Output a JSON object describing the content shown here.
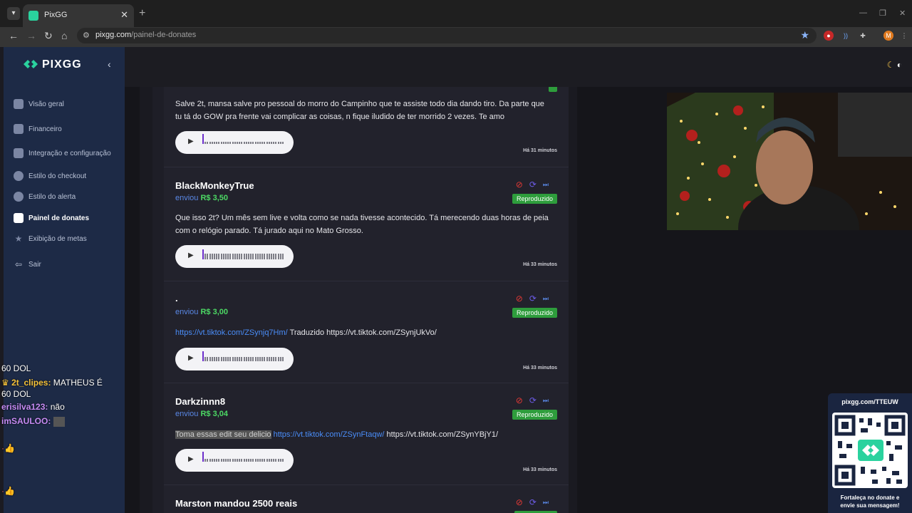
{
  "browser": {
    "tab_title": "PixGG",
    "url_domain": "pixgg.com",
    "url_path": "/painel-de-donates",
    "profile_initial": "M"
  },
  "sidebar": {
    "logo": "PIXGG",
    "items": [
      {
        "label": "Visão geral",
        "icon": "home-icon"
      },
      {
        "label": "Financeiro",
        "icon": "wallet-icon"
      },
      {
        "label": "Integração e configuração",
        "icon": "integration-icon"
      },
      {
        "label": "Estilo do checkout",
        "icon": "palette-icon"
      },
      {
        "label": "Estilo do alerta",
        "icon": "palette-icon"
      },
      {
        "label": "Painel de donates",
        "icon": "donate-icon"
      },
      {
        "label": "Exibição de metas",
        "icon": "star-icon"
      },
      {
        "label": "Sair",
        "icon": "logout-icon"
      }
    ],
    "active_index": 5
  },
  "donations": [
    {
      "name": "",
      "sent_label": "",
      "amount": "",
      "message": "Salve 2t, mansa salve pro pessoal do morro do Campinho que te assiste todo dia dando tiro. Da parte que tu tá do GOW pra frente vai complicar as coisas, n fique iludido de ter morrido 2 vezes. Te amo",
      "time": "Há 31 minutos"
    },
    {
      "name": "BlackMonkeyTrue",
      "sent_label": "enviou",
      "amount": "R$ 3,50",
      "status": "Reproduzido",
      "message": "Que isso 2t? Um mês sem live e volta como se nada tivesse acontecido. Tá merecendo duas horas de peia com o relógio parado. Tá jurado aqui no Mato Grosso.",
      "time": "Há 33 minutos"
    },
    {
      "name": ".",
      "sent_label": "enviou",
      "amount": "R$ 3,00",
      "status": "Reproduzido",
      "link": "https://vt.tiktok.com/ZSynjq7Hm/",
      "message_after": " Traduzido https://vt.tiktok.com/ZSynjUkVo/",
      "time": "Há 33 minutos"
    },
    {
      "name": "Darkzinnn8",
      "sent_label": "enviou",
      "amount": "R$ 3,04",
      "status": "Reproduzido",
      "highlight": "Toma essas edit seu delicio",
      "link": " https://vt.tiktok.com/ZSynFtaqw/",
      "message_after": " https://vt.tiktok.com/ZSynYBjY1/",
      "time": "Há 33 minutos"
    },
    {
      "name": "Marston mandou 2500 reais"
    }
  ],
  "chat": [
    {
      "user": "",
      "text": "60 DOL",
      "color": "#ffffff"
    },
    {
      "user": "2t_clipes:",
      "text": " MATHEUS É",
      "color": "#f5c23a"
    },
    {
      "user": "",
      "text": "60 DOL",
      "color": "#ffffff"
    },
    {
      "user": "erisilva123:",
      "text": " não",
      "color": "#c78cf5"
    },
    {
      "user": "imSAULOO:",
      "text": "",
      "color": "#c78cf5"
    }
  ],
  "promo": {
    "url": "pixgg.com/TTEUW",
    "cta_line1": "Fortaleça no donate e",
    "cta_line2": "envie sua mensagem!"
  }
}
